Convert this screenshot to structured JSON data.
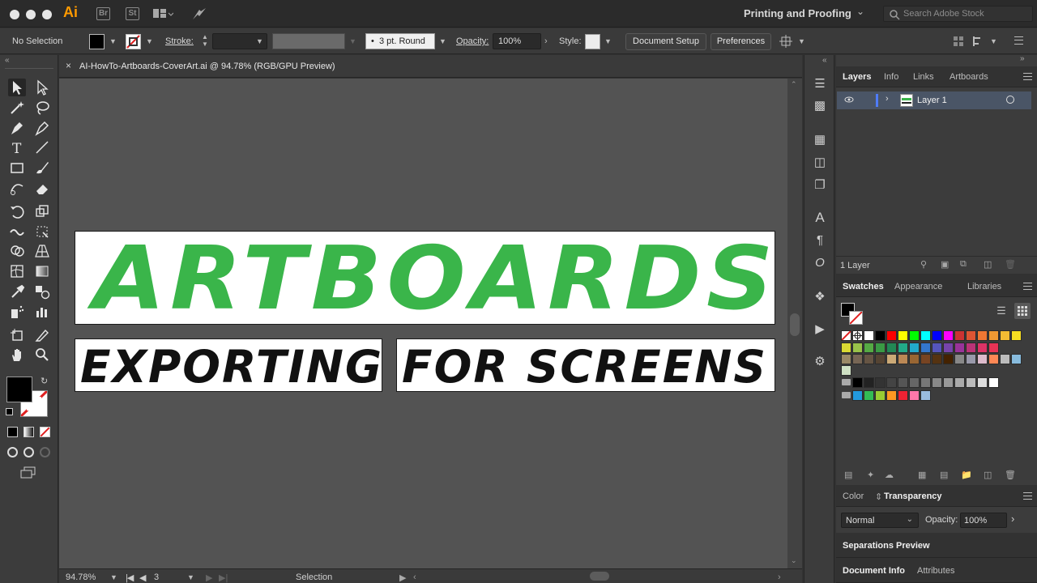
{
  "app": {
    "logo": "Ai",
    "bridge_label": "Br",
    "stock_label": "St",
    "workspace": "Printing and Proofing",
    "search_placeholder": "Search Adobe Stock"
  },
  "control_bar": {
    "selection_status": "No Selection",
    "stroke_label": "Stroke:",
    "brush_value": "3 pt. Round",
    "opacity_label": "Opacity:",
    "opacity_value": "100%",
    "style_label": "Style:",
    "document_setup": "Document Setup",
    "preferences": "Preferences"
  },
  "document": {
    "tab_close": "×",
    "tab_title": "AI-HowTo-Artboards-CoverArt.ai @ 94.78% (RGB/GPU Preview)",
    "artboards": [
      {
        "text": "ARTBOARDS",
        "color": "#3ab54a"
      },
      {
        "text": "EXPORTING",
        "color": "#111111"
      },
      {
        "text": "FOR SCREENS",
        "color": "#111111"
      }
    ]
  },
  "status_bar": {
    "zoom": "94.78%",
    "artboard_number": "3",
    "current_tool": "Selection"
  },
  "layers_panel": {
    "tabs": [
      "Layers",
      "Info",
      "Links",
      "Artboards"
    ],
    "active_tab": "Layers",
    "layers": [
      {
        "name": "Layer 1"
      }
    ],
    "count": "1 Layer"
  },
  "swatches_panel": {
    "tabs": [
      "Swatches",
      "Appearance",
      "Libraries"
    ],
    "active_tab": "Swatches",
    "row1": [
      "#ffffff",
      "#000000",
      "#ff0000",
      "#ffff00",
      "#00ff00",
      "#00ffff",
      "#0000ff",
      "#ff00ff",
      "#cc3333",
      "#dd5533",
      "#ee7733",
      "#f09933",
      "#f3bb33",
      "#f5dd22"
    ],
    "row2": [
      "#d9d933",
      "#99c24a",
      "#55aa44",
      "#3a9a44",
      "#228855",
      "#22aa88",
      "#22aacc",
      "#3377cc",
      "#5555bb",
      "#7744aa",
      "#993399",
      "#bb3377",
      "#dd3366",
      "#e83355"
    ],
    "row3": [
      "#998866",
      "#776655",
      "#665544",
      "#554433",
      "#ccaa77",
      "#bb8855",
      "#996633",
      "#774422",
      "#553311",
      "#442200",
      "#888888",
      "#9999aa",
      "#ddbbcc",
      "#ff8855",
      "#bbbbbb",
      "#88bbdd"
    ],
    "grays": [
      "#000000",
      "#222222",
      "#333333",
      "#444444",
      "#555555",
      "#666666",
      "#777777",
      "#888888",
      "#999999",
      "#aaaaaa",
      "#bbbbbb",
      "#dddddd",
      "#ffffff"
    ],
    "colors_group": [
      "#2299dd",
      "#33bb55",
      "#99cc33",
      "#ff9922",
      "#ee2233",
      "#ff77aa",
      "#99bbdd"
    ]
  },
  "transparency_panel": {
    "tabs": [
      "Color",
      "Transparency"
    ],
    "active_tab": "Transparency",
    "blend_mode": "Normal",
    "opacity_label": "Opacity:",
    "opacity_value": "100%"
  },
  "separations_panel": {
    "title": "Separations Preview"
  },
  "document_info_panel": {
    "tabs": [
      "Document Info",
      "Attributes"
    ],
    "active_tab": "Document Info"
  }
}
